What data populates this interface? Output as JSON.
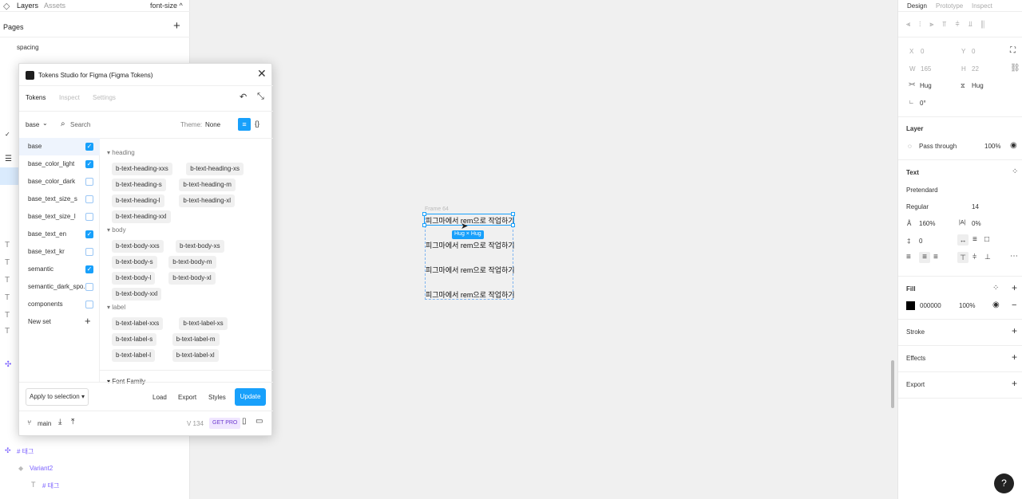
{
  "left_panel": {
    "tabs": {
      "layers": "Layers",
      "assets": "Assets",
      "page_selector": "font-size ^"
    },
    "pages_title": "Pages",
    "pages": [
      "spacing"
    ],
    "bottom_layers": [
      {
        "label": "# 태그"
      },
      {
        "label": "Variant2"
      },
      {
        "label": "# 태그"
      }
    ]
  },
  "plugin": {
    "title": "Tokens Studio for Figma (Figma Tokens)",
    "tabs": [
      "Tokens",
      "Inspect",
      "Settings"
    ],
    "set_selector": "base",
    "search_placeholder": "Search",
    "theme_label": "Theme:",
    "theme_value": "None",
    "sets": [
      {
        "label": "base",
        "checked": true,
        "active": true
      },
      {
        "label": "base_color_light",
        "checked": true
      },
      {
        "label": "base_color_dark",
        "checked": false
      },
      {
        "label": "base_text_size_s",
        "checked": false
      },
      {
        "label": "base_text_size_l",
        "checked": false
      },
      {
        "label": "base_text_en",
        "checked": true
      },
      {
        "label": "base_text_kr",
        "checked": false
      },
      {
        "label": "semantic",
        "checked": true
      },
      {
        "label": "semantic_dark_spo...",
        "checked": false
      },
      {
        "label": "components",
        "checked": false
      }
    ],
    "new_set": "New set",
    "groups": {
      "heading": {
        "name": "heading",
        "tokens": [
          "b-text-heading-xxs",
          "b-text-heading-xs",
          "b-text-heading-s",
          "b-text-heading-m",
          "b-text-heading-l",
          "b-text-heading-xl",
          "b-text-heading-xxl"
        ]
      },
      "body": {
        "name": "body",
        "tokens": [
          "b-text-body-xxs",
          "b-text-body-xs",
          "b-text-body-s",
          "b-text-body-m",
          "b-text-body-l",
          "b-text-body-xl",
          "b-text-body-xxl"
        ]
      },
      "label": {
        "name": "label",
        "tokens": [
          "b-text-label-xxs",
          "b-text-label-xs",
          "b-text-label-s",
          "b-text-label-m",
          "b-text-label-l",
          "b-text-label-xl"
        ]
      }
    },
    "font_family_header": "Font Family",
    "apply_button": "Apply to selection",
    "load": "Load",
    "export": "Export",
    "styles": "Styles",
    "update": "Update",
    "branch": "main",
    "version": "V 134",
    "get_pro": "GET PRO"
  },
  "canvas": {
    "frame_label": "Frame 64",
    "texts": [
      "피그마에서 rem으로 작업하기",
      "피그마에서 rem으로 작업하기",
      "피그마에서 rem으로 작업하기",
      "피그마에서 rem으로 작업하기"
    ],
    "hug_badge": "Hug × Hug"
  },
  "right_panel": {
    "tabs": [
      "Design",
      "Prototype",
      "Inspect"
    ],
    "x_label": "X",
    "x": "0",
    "y_label": "Y",
    "y": "0",
    "w_label": "W",
    "w": "165",
    "h_label": "H",
    "h": "22",
    "hug_w": "Hug",
    "hug_h": "Hug",
    "rotation": "0°",
    "layer_title": "Layer",
    "blend": "Pass through",
    "opacity": "100%",
    "text_title": "Text",
    "font_family": "Pretendard",
    "font_weight": "Regular",
    "font_size": "14",
    "line_height": "160%",
    "letter_spacing": "0%",
    "para_spacing": "0",
    "fill_title": "Fill",
    "fill_hex": "000000",
    "fill_opacity": "100%",
    "fill_color": "#000000",
    "stroke_title": "Stroke",
    "effects_title": "Effects",
    "export_title": "Export"
  },
  "help": "?"
}
